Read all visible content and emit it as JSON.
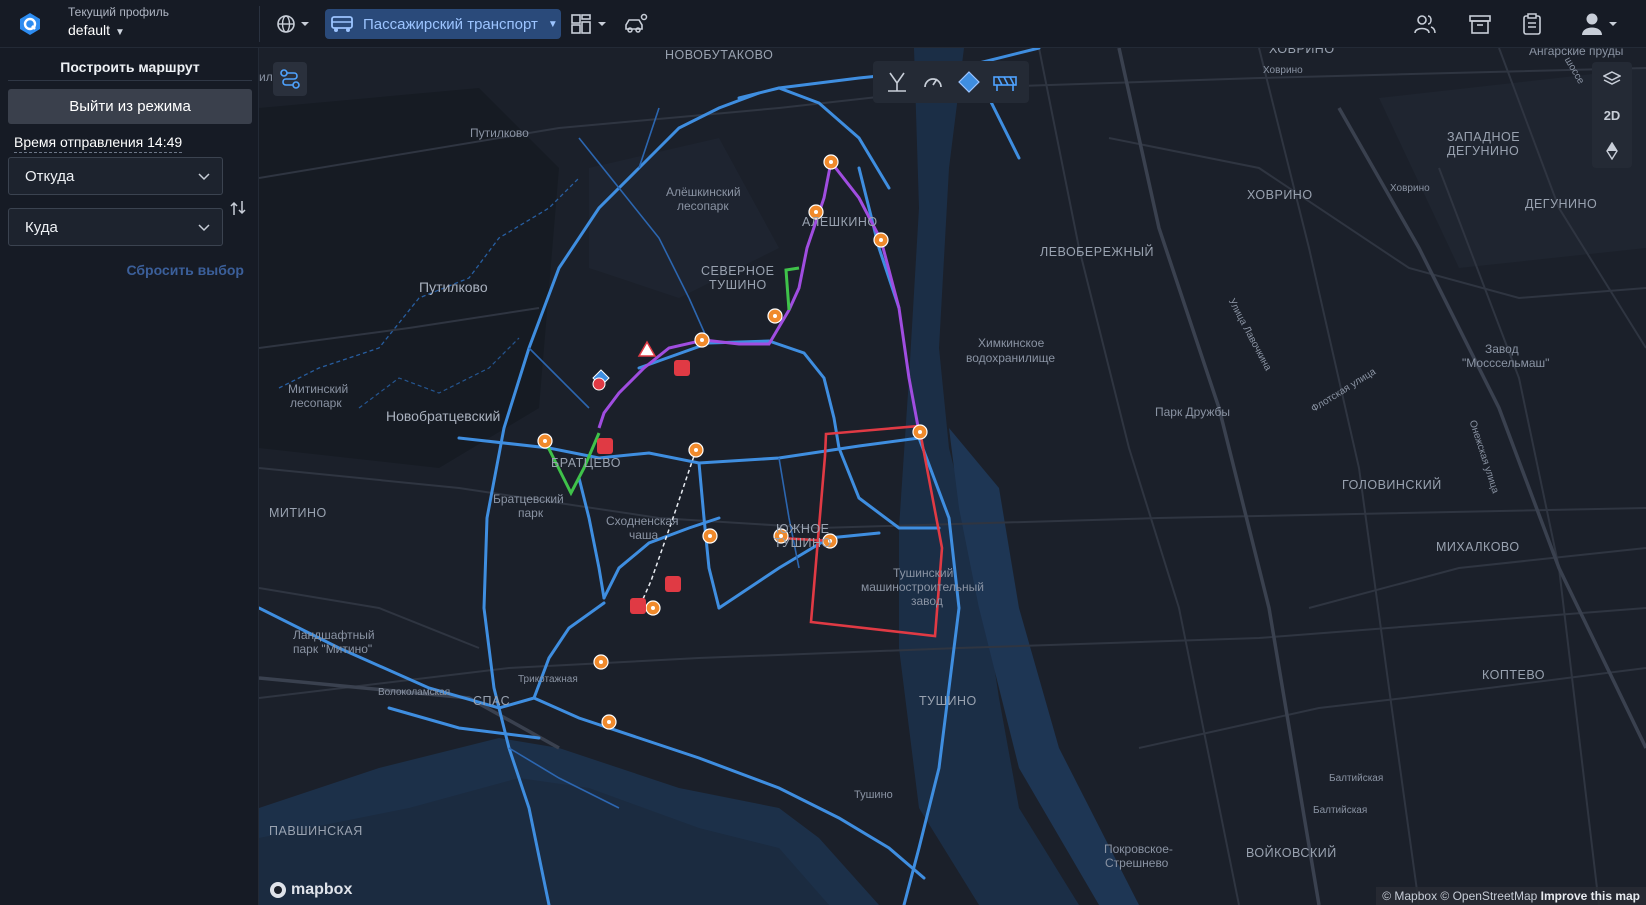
{
  "topbar": {
    "profile_caption": "Текущий профиль",
    "profile_value": "default",
    "mode_label": "Пассажирский транспорт"
  },
  "sidebar": {
    "title": "Построить маршрут",
    "exit_button": "Выйти из режима",
    "departure": "Время отправления 14:49",
    "from_placeholder": "Откуда",
    "to_placeholder": "Куда",
    "reset": "Сбросить выбор"
  },
  "map": {
    "labels": {
      "novobutakovo": "НОВОБУТАКОВО",
      "putilkovo_small": "Путилково",
      "putilkovo": "Путилково",
      "putilkovo_edge": "илково",
      "aleshkinsky1": "Алёшкинский",
      "aleshkinsky2": "лесопарк",
      "aleshkino": "АЛЕШКИНО",
      "severnoe1": "СЕВЕРНОЕ",
      "severnoe2": "ТУШИНО",
      "levoberezhny": "ЛЕВОБЕРЕЖНЫЙ",
      "khovrino": "ХОВРИНО",
      "khovrino_small": "Ховрино",
      "khovrino_small2": "Ховрино",
      "zapadnoe1": "ЗАПАДНОЕ",
      "zapadnoe2": "ДЕГУНИНО",
      "degunino": "ДЕГУНИНО",
      "angarskie": "Ангарские пруды",
      "khimki1": "Химкинское",
      "khimki2": "водохранилище",
      "zavod1": "Завод",
      "zavod2": "\"Мосссельмаш\"",
      "park_druzhby": "Парк Дружбы",
      "mitinsky1": "Митинский",
      "mitinsky2": "лесопарк",
      "novobratsevsky": "Новобратцевский",
      "bratsevo": "БРАТЦЕВО",
      "bratsevsky1": "Братцевский",
      "bratsevsky2": "парк",
      "skhodnenskaya1": "Сходненская",
      "skhodnenskaya2": "чаша",
      "yuzhnoe1": "ЮЖНОЕ",
      "yuzhnoe2": "ТУШИНО",
      "tms1": "Тушинский",
      "tms2": "машиностроительный",
      "tms3": "завод",
      "golovinsky": "ГОЛОВИНСКИЙ",
      "mikhalkovo": "МИХАЛКОВО",
      "mitino": "МИТИНО",
      "landshaft1": "Ландшафтный",
      "landshaft2": "парк \"Митино\"",
      "volokolamskaya": "Волоколамская",
      "trikotazhnaya": "Трикотажная",
      "spas": "СПАС",
      "tushino_dist": "ТУШИНО",
      "tushino": "Тушино",
      "koptevo": "КОПТЕВО",
      "baltiyskaya": "Балтийская",
      "baltiyskaya2": "Балтийская",
      "pavshinskaya": "ПАВШИНСКАЯ",
      "pokrovskoe1": "Покровское-",
      "pokrovskoe2": "Стрешнево",
      "voykovsky": "ВОЙКОВСКИЙ",
      "ul_lavochkina": "Улица Лавочкина",
      "flotskaya": "Флотская улица",
      "onezhskaya": "Онежская улица",
      "shosse": "шоссе",
      "khovrino_top": "ХОВРИНО"
    },
    "view_2d": "2D",
    "mapbox": "mapbox",
    "attribution_text": "© Mapbox © OpenStreetMap",
    "attribution_link": "Improve this map"
  },
  "colors": {
    "accent": "#2a4a7a",
    "route_purple": "#a04de0",
    "route_red": "#e03a44",
    "route_green": "#3fc24a",
    "road_blue": "#3f8ee0",
    "marker_orange": "#f08a2c"
  }
}
